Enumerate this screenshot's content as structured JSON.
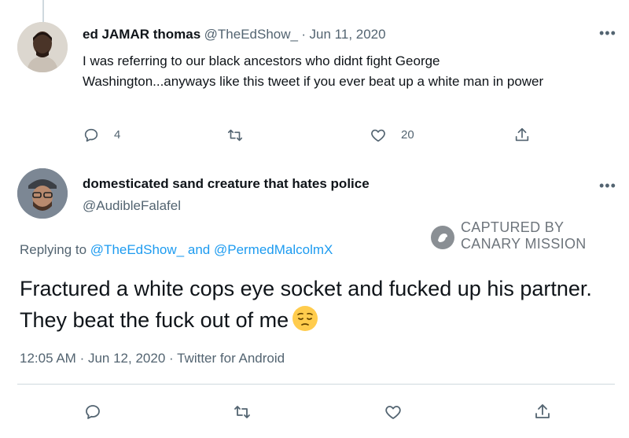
{
  "tweet1": {
    "display_name": "ed JAMAR thomas",
    "handle": "@TheEdShow_",
    "separator": "·",
    "date": "Jun 11, 2020",
    "text": "I was referring to our black ancestors who didnt fight George Washington...anyways like this tweet if you ever beat up a white man in power",
    "reply_count": "4",
    "like_count": "20",
    "more_icon": "more-dots-icon"
  },
  "tweet2": {
    "display_name": "domesticated sand creature that hates police",
    "handle": "@AudibleFalafel",
    "replying_prefix": "Replying to",
    "replying_user1": "@TheEdShow_",
    "replying_and": "and",
    "replying_user2": "@PermedMalcolmX",
    "text": "Fractured a white cops eye socket and fucked up his partner. They beat the fuck out of me",
    "emoji": "pensive-face-emoji",
    "time": "12:05 AM",
    "separator": "·",
    "date": "Jun 12, 2020",
    "client": "Twitter for Android"
  },
  "watermark": {
    "line1": "CAPTURED BY",
    "line2": "CANARY MISSION"
  },
  "colors": {
    "link": "#1d9bf0",
    "muted": "#536471",
    "text": "#0f1419",
    "emoji": "#ffcc4d"
  }
}
